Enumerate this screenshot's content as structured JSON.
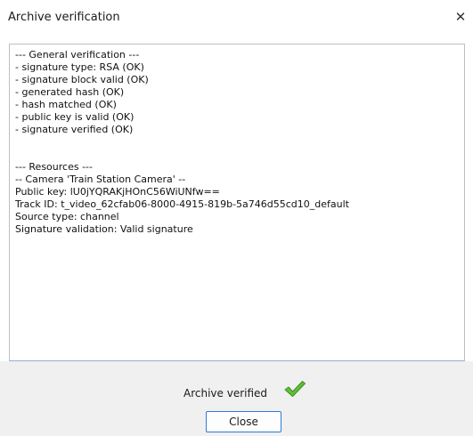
{
  "window": {
    "title": "Archive verification",
    "close_glyph": "✕"
  },
  "log": {
    "lines": [
      "--- General verification ---",
      " - signature type: RSA (OK)",
      " - signature block valid (OK)",
      " - generated hash (OK)",
      " - hash matched (OK)",
      " - public key is valid (OK)",
      " - signature verified (OK)",
      "",
      "",
      "--- Resources ---",
      "-- Camera 'Train Station Camera' --",
      " Public key: lU0jYQRAKjHOnC56WiUNfw==",
      " Track ID: t_video_62cfab06-8000-4915-819b-5a746d55cd10_default",
      " Source type: channel",
      " Signature validation: Valid signature"
    ]
  },
  "footer": {
    "status_text": "Archive verified",
    "status_icon": "green-check-icon",
    "close_label": "Close"
  },
  "colors": {
    "check_green": "#5fbf3a",
    "button_border": "#2f7bd6",
    "footer_bg": "#f0f0f0"
  }
}
